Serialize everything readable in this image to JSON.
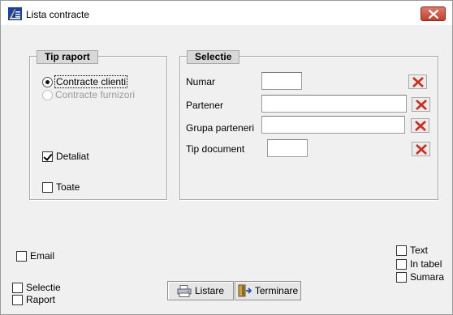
{
  "window": {
    "title": "Lista contracte",
    "close_icon": "close-icon",
    "app_icon": "app-icon"
  },
  "tip_raport": {
    "title": "Tip raport",
    "options": [
      {
        "label": "Contracte clienti",
        "checked": true,
        "enabled": true
      },
      {
        "label": "Contracte furnizori",
        "checked": false,
        "enabled": false
      }
    ],
    "detaliat": {
      "label": "Detaliat",
      "checked": true
    },
    "toate": {
      "label": "Toate",
      "checked": false
    }
  },
  "selectie": {
    "title": "Selectie",
    "fields": [
      {
        "label": "Numar",
        "value": ""
      },
      {
        "label": "Partener",
        "value": ""
      },
      {
        "label": "Grupa parteneri",
        "value": ""
      },
      {
        "label": "Tip document",
        "value": ""
      }
    ]
  },
  "options": {
    "email": {
      "label": "Email",
      "checked": false
    },
    "selectie": {
      "label": "Selectie",
      "checked": false
    },
    "raport": {
      "label": "Raport",
      "checked": false
    },
    "text": {
      "label": "Text",
      "checked": false
    },
    "in_tabel": {
      "label": "In tabel",
      "checked": false
    },
    "sumara": {
      "label": "Sumara",
      "checked": false
    }
  },
  "buttons": {
    "listare": "Listare",
    "terminare": "Terminare"
  },
  "colors": {
    "window_bg": "#f0f0f0",
    "close_red": "#c2402c",
    "clear_x_red": "#d42a1a"
  }
}
